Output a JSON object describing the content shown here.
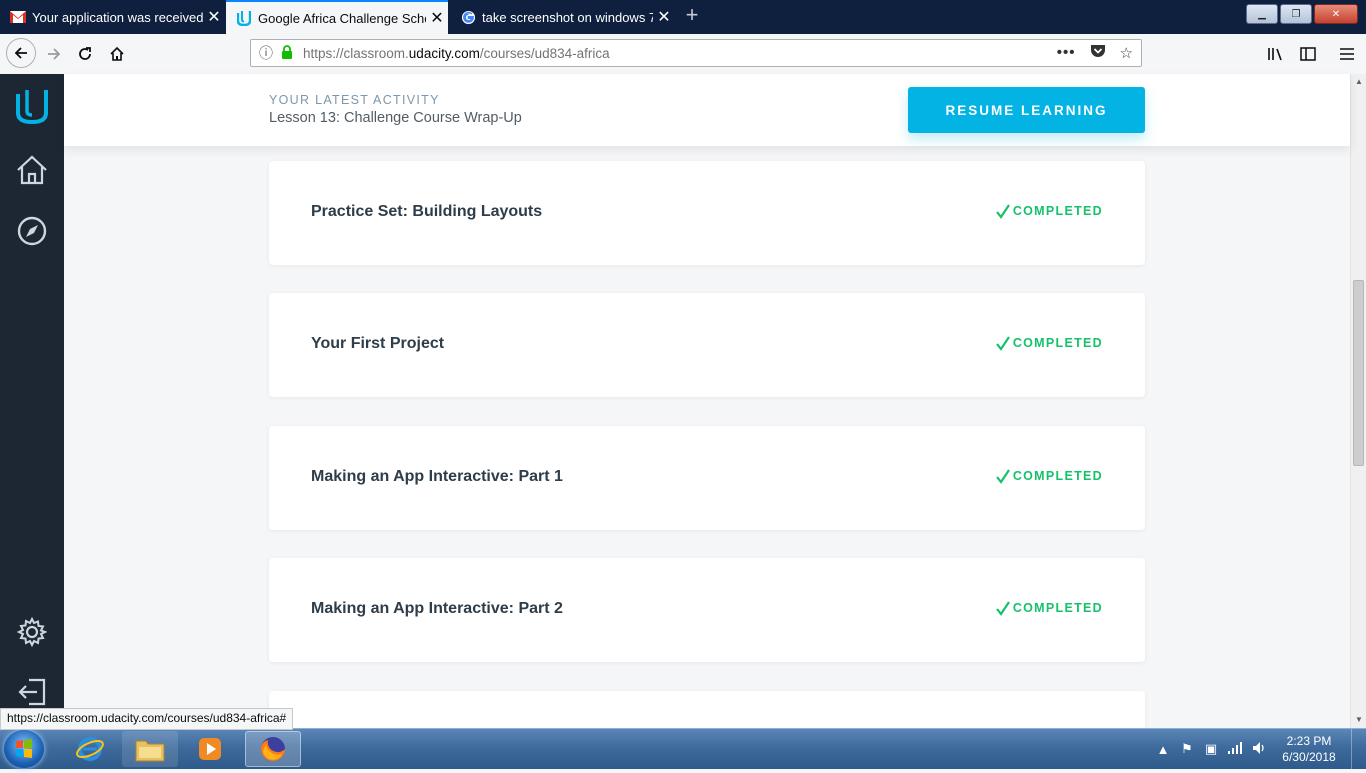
{
  "browser": {
    "tabs": [
      {
        "title": "Your application was received!",
        "favicon": "gmail-icon",
        "active": false
      },
      {
        "title": "Google Africa Challenge Schola",
        "favicon": "udacity-icon",
        "active": true
      },
      {
        "title": "take screenshot on windows 7",
        "favicon": "google-icon",
        "active": false
      }
    ],
    "url_prefix": "https://classroom.",
    "url_domain": "udacity.com",
    "url_path": "/courses/ud834-africa",
    "status_url": "https://classroom.udacity.com/courses/ud834-africa#"
  },
  "activity": {
    "label": "YOUR LATEST ACTIVITY",
    "lesson": "Lesson 13: Challenge Course Wrap-Up",
    "resume_label": "RESUME LEARNING"
  },
  "lessons": [
    {
      "title": "Practice Set: Building Layouts",
      "status": "COMPLETED"
    },
    {
      "title": "Your First Project",
      "status": "COMPLETED"
    },
    {
      "title": "Making an App Interactive: Part 1",
      "status": "COMPLETED"
    },
    {
      "title": "Making an App Interactive: Part 2",
      "status": "COMPLETED"
    }
  ],
  "taskbar": {
    "time": "2:23 PM",
    "date": "6/30/2018"
  },
  "colors": {
    "udacity_blue": "#02b3e4",
    "completed_green": "#15c26b",
    "sidebar_bg": "#1d2633"
  }
}
